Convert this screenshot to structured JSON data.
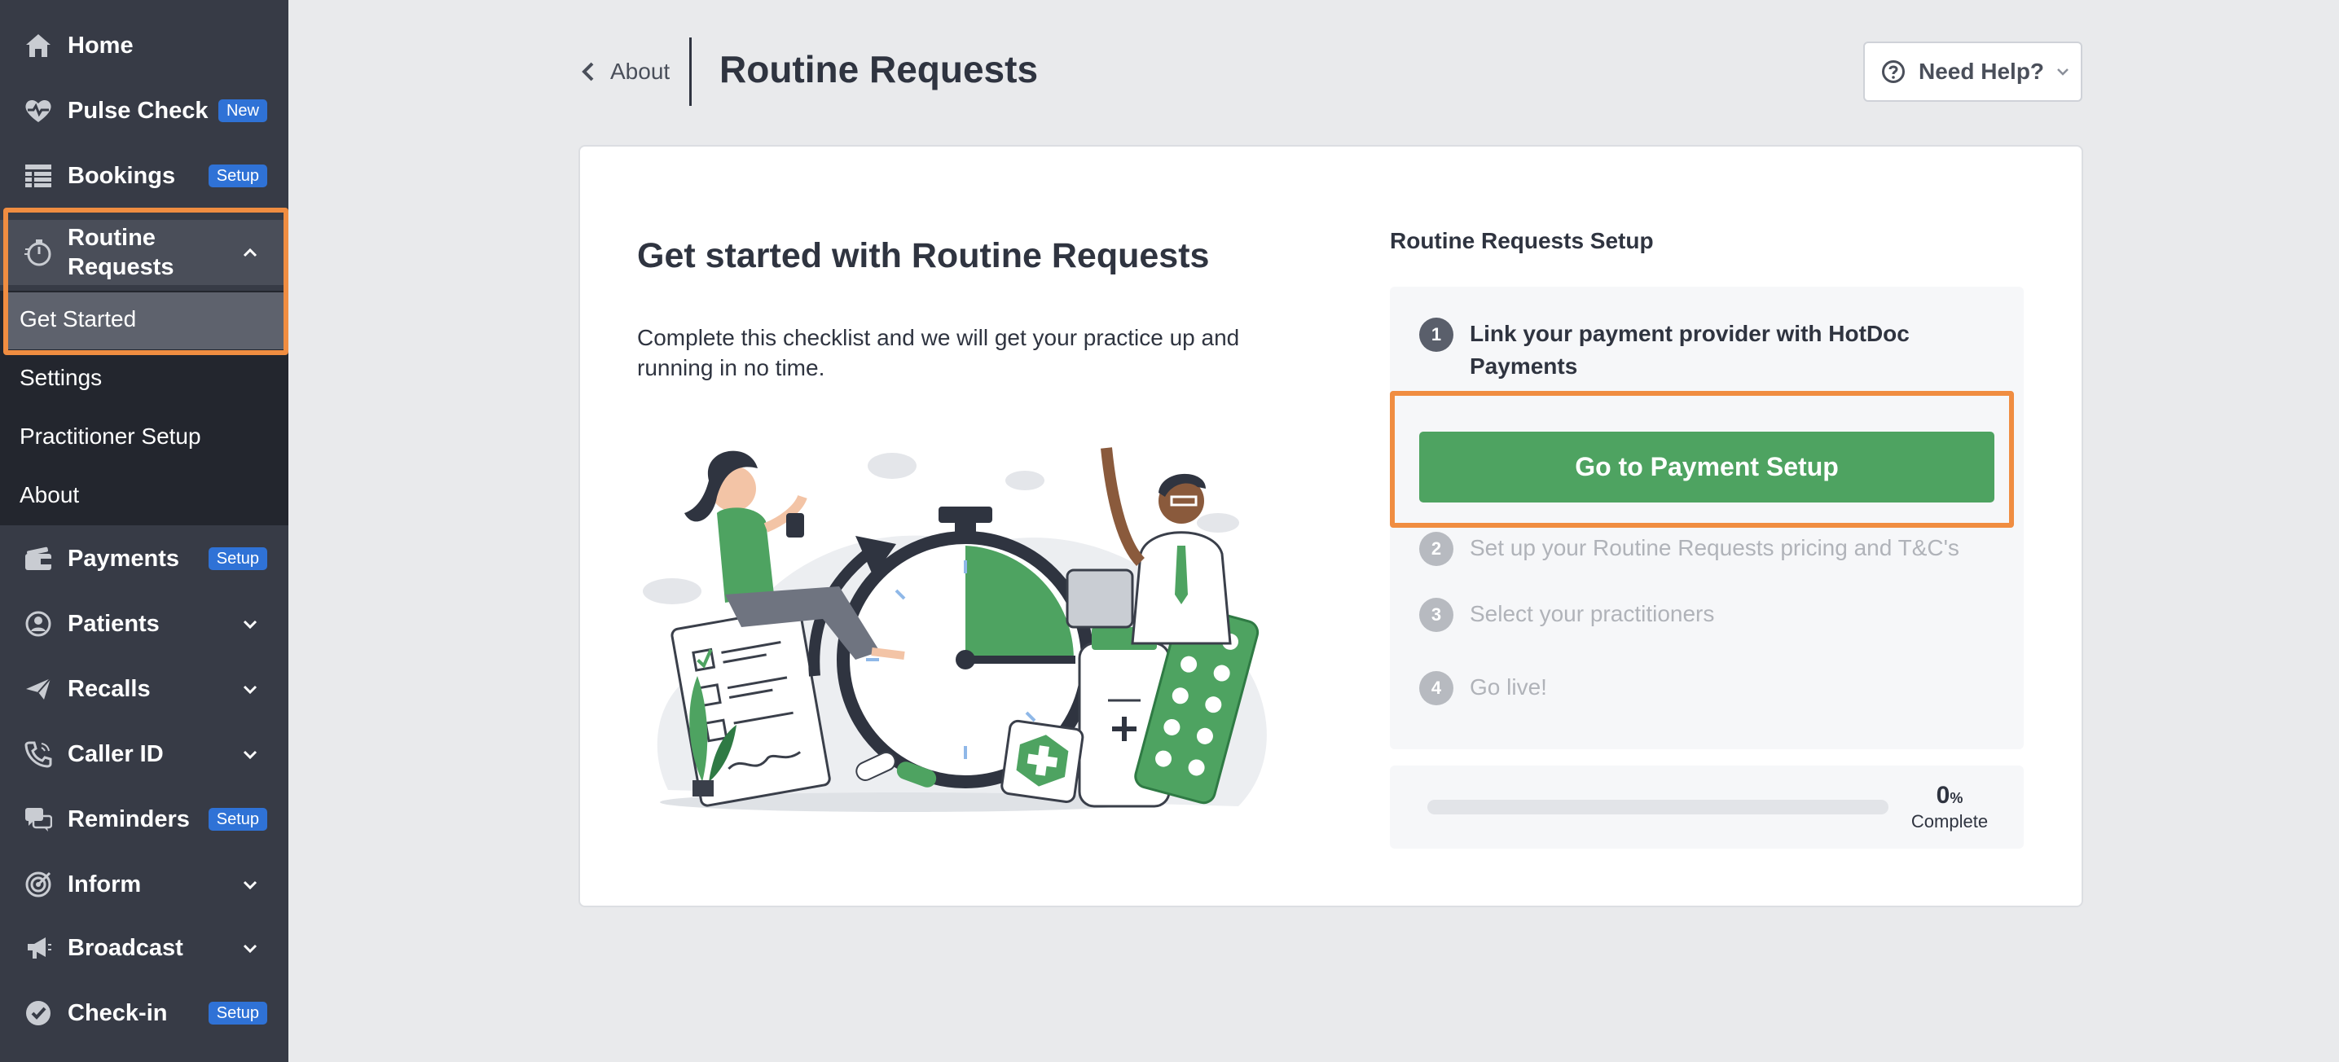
{
  "sidebar": {
    "items": [
      {
        "label": "Home",
        "icon": "home-icon"
      },
      {
        "label": "Pulse Check",
        "icon": "heart-pulse-icon",
        "badge": "New"
      },
      {
        "label": "Bookings",
        "icon": "calendar-grid-icon",
        "badge": "Setup"
      },
      {
        "label": "Routine Requests",
        "icon": "stopwatch-icon",
        "expanded": true
      },
      {
        "label": "Payments",
        "icon": "wallet-icon",
        "badge": "Setup"
      },
      {
        "label": "Patients",
        "icon": "person-circle-icon"
      },
      {
        "label": "Recalls",
        "icon": "paper-plane-icon"
      },
      {
        "label": "Caller ID",
        "icon": "phone-icon"
      },
      {
        "label": "Reminders",
        "icon": "chat-bubbles-icon",
        "badge": "Setup"
      },
      {
        "label": "Inform",
        "icon": "target-icon"
      },
      {
        "label": "Broadcast",
        "icon": "megaphone-icon"
      },
      {
        "label": "Check-in",
        "icon": "check-badge-icon",
        "badge": "Setup"
      }
    ],
    "routine_label_line1": "Routine",
    "routine_label_line2": "Requests",
    "submenu": [
      {
        "label": "Get Started",
        "active": true
      },
      {
        "label": "Settings"
      },
      {
        "label": "Practitioner Setup"
      },
      {
        "label": "About"
      }
    ]
  },
  "header": {
    "back_label": "About",
    "title": "Routine Requests",
    "help_label": "Need Help?"
  },
  "main": {
    "heading": "Get started with Routine Requests",
    "intro": "Complete this checklist and we will get your practice up and running in no time."
  },
  "setup": {
    "title": "Routine Requests Setup",
    "steps": [
      {
        "num": "1",
        "label": "Link your payment provider with HotDoc Payments",
        "state": "current"
      },
      {
        "num": "2",
        "label": "Set up your Routine Requests pricing and T&C's",
        "state": "pending"
      },
      {
        "num": "3",
        "label": "Select your practitioners",
        "state": "pending"
      },
      {
        "num": "4",
        "label": "Go live!",
        "state": "pending"
      }
    ],
    "cta_label": "Go to Payment Setup",
    "progress": {
      "value": "0",
      "unit": "%",
      "label": "Complete",
      "fraction": 0
    }
  },
  "colors": {
    "sidebar_bg": "#373b46",
    "submenu_bg": "#23262e",
    "accent_orange": "#f08d41",
    "primary_green": "#4ea361",
    "badge_blue": "#2f72d6",
    "page_bg": "#e9eaec"
  }
}
